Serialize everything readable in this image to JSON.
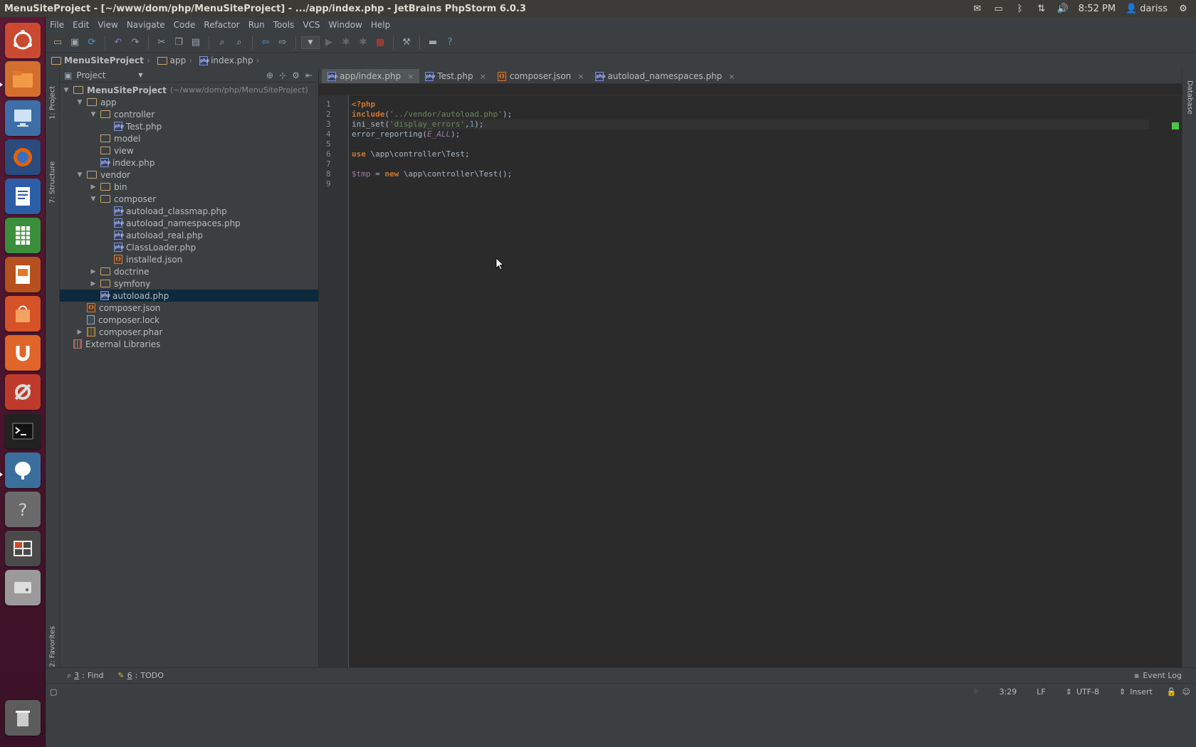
{
  "window": {
    "title": "MenuSiteProject - [~/www/dom/php/MenuSiteProject] - .../app/index.php - JetBrains PhpStorm 6.0.3"
  },
  "panel": {
    "time": "8:52 PM",
    "user": "dariss"
  },
  "menu": [
    "File",
    "Edit",
    "View",
    "Navigate",
    "Code",
    "Refactor",
    "Run",
    "Tools",
    "VCS",
    "Window",
    "Help"
  ],
  "breadcrumb": {
    "project": "MenuSiteProject",
    "folder": "app",
    "file": "index.php"
  },
  "project_panel": {
    "header": "Project",
    "root": {
      "name": "MenuSiteProject",
      "path": "(~/www/dom/php/MenuSiteProject)"
    },
    "rows": [
      {
        "label": "app",
        "type": "folder",
        "depth": 1,
        "arrow": "open"
      },
      {
        "label": "controller",
        "type": "folder",
        "depth": 2,
        "arrow": "open"
      },
      {
        "label": "Test.php",
        "type": "php",
        "depth": 3,
        "arrow": "none"
      },
      {
        "label": "model",
        "type": "folder",
        "depth": 2,
        "arrow": "none"
      },
      {
        "label": "view",
        "type": "folder",
        "depth": 2,
        "arrow": "none"
      },
      {
        "label": "index.php",
        "type": "php",
        "depth": 2,
        "arrow": "none"
      },
      {
        "label": "vendor",
        "type": "folder",
        "depth": 1,
        "arrow": "open"
      },
      {
        "label": "bin",
        "type": "folder",
        "depth": 2,
        "arrow": "closed"
      },
      {
        "label": "composer",
        "type": "folder",
        "depth": 2,
        "arrow": "open"
      },
      {
        "label": "autoload_classmap.php",
        "type": "php",
        "depth": 3,
        "arrow": "none"
      },
      {
        "label": "autoload_namespaces.php",
        "type": "php",
        "depth": 3,
        "arrow": "none"
      },
      {
        "label": "autoload_real.php",
        "type": "php",
        "depth": 3,
        "arrow": "none"
      },
      {
        "label": "ClassLoader.php",
        "type": "php",
        "depth": 3,
        "arrow": "none"
      },
      {
        "label": "installed.json",
        "type": "json",
        "depth": 3,
        "arrow": "none"
      },
      {
        "label": "doctrine",
        "type": "folder",
        "depth": 2,
        "arrow": "closed"
      },
      {
        "label": "symfony",
        "type": "folder",
        "depth": 2,
        "arrow": "closed"
      },
      {
        "label": "autoload.php",
        "type": "php",
        "depth": 2,
        "arrow": "none",
        "selected": true
      },
      {
        "label": "composer.json",
        "type": "json",
        "depth": 1,
        "arrow": "none"
      },
      {
        "label": "composer.lock",
        "type": "lock",
        "depth": 1,
        "arrow": "none"
      },
      {
        "label": "composer.phar",
        "type": "jar",
        "depth": 1,
        "arrow": "closed"
      },
      {
        "label": "External Libraries",
        "type": "lib",
        "depth": 0,
        "arrow": "none"
      }
    ]
  },
  "tabs": [
    {
      "label": "app/index.php",
      "type": "php",
      "active": true
    },
    {
      "label": "Test.php",
      "type": "php",
      "active": false
    },
    {
      "label": "composer.json",
      "type": "json",
      "active": false
    },
    {
      "label": "autoload_namespaces.php",
      "type": "php",
      "active": false
    }
  ],
  "side_tabs": {
    "project": "1: Project",
    "structure": "7: Structure",
    "favorites": "2: Favorites",
    "database": "Database"
  },
  "code": {
    "line_numbers": [
      "1",
      "2",
      "3",
      "4",
      "5",
      "6",
      "7",
      "8",
      "9"
    ],
    "lines": [
      [
        {
          "t": "<?php",
          "c": "tag"
        }
      ],
      [
        {
          "t": "include",
          "c": "kw"
        },
        {
          "t": "(",
          "c": ""
        },
        {
          "t": "'../vendor/autoload.php'",
          "c": "str"
        },
        {
          "t": ");",
          "c": ""
        }
      ],
      [
        {
          "t": "ini_set(",
          "c": ""
        },
        {
          "t": "'display_errors'",
          "c": "str"
        },
        {
          "t": ",",
          "c": ""
        },
        {
          "t": "1",
          "c": "num"
        },
        {
          "t": ");",
          "c": ""
        }
      ],
      [
        {
          "t": "error_reporting(",
          "c": ""
        },
        {
          "t": "E_ALL",
          "c": "const"
        },
        {
          "t": ");",
          "c": ""
        }
      ],
      [],
      [
        {
          "t": "use",
          "c": "kw"
        },
        {
          "t": " \\app\\controller\\Test;",
          "c": ""
        }
      ],
      [],
      [
        {
          "t": "$tmp",
          "c": "var"
        },
        {
          "t": " = ",
          "c": ""
        },
        {
          "t": "new",
          "c": "kw"
        },
        {
          "t": " \\app\\controller\\Test();",
          "c": ""
        }
      ],
      []
    ]
  },
  "bottom": {
    "find_num": "3",
    "find": "Find",
    "todo_num": "6",
    "todo": "TODO",
    "event_log": "Event Log"
  },
  "status": {
    "position": "3:29",
    "line_sep": "LF",
    "encoding": "UTF-8",
    "mode": "Insert"
  }
}
